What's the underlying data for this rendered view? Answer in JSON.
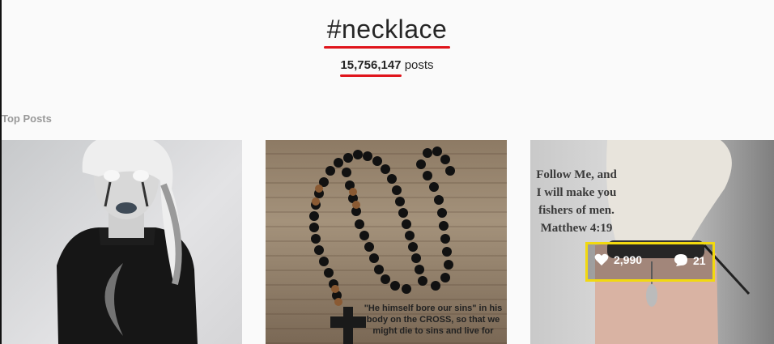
{
  "hashtag": {
    "title": "#necklace",
    "post_count": "15,756,147",
    "posts_suffix": "posts"
  },
  "section": {
    "label": "Top Posts"
  },
  "posts": [
    {
      "id": "post-1"
    },
    {
      "id": "post-2",
      "caption": "\"He himself bore our sins\" in his body on the CROSS, so that we might die to sins and live for"
    },
    {
      "id": "post-3",
      "verse": "Follow Me, and I will make you fishers of men. Matthew 4:19",
      "likes": "2,990",
      "comments": "21"
    }
  ],
  "colors": {
    "accent_underline": "#e0141b",
    "highlight_box": "#f2d90f"
  }
}
